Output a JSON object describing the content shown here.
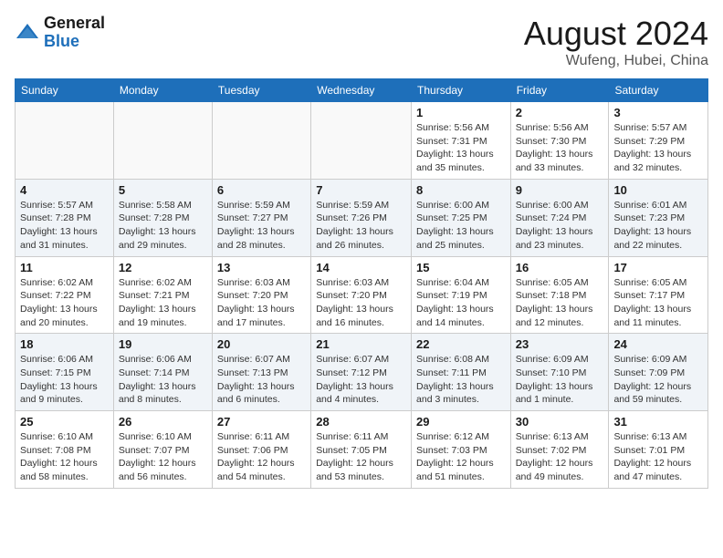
{
  "header": {
    "logo_general": "General",
    "logo_blue": "Blue",
    "month_year": "August 2024",
    "location": "Wufeng, Hubei, China"
  },
  "days_of_week": [
    "Sunday",
    "Monday",
    "Tuesday",
    "Wednesday",
    "Thursday",
    "Friday",
    "Saturday"
  ],
  "weeks": [
    [
      {
        "day": "",
        "info": ""
      },
      {
        "day": "",
        "info": ""
      },
      {
        "day": "",
        "info": ""
      },
      {
        "day": "",
        "info": ""
      },
      {
        "day": "1",
        "info": "Sunrise: 5:56 AM\nSunset: 7:31 PM\nDaylight: 13 hours and 35 minutes."
      },
      {
        "day": "2",
        "info": "Sunrise: 5:56 AM\nSunset: 7:30 PM\nDaylight: 13 hours and 33 minutes."
      },
      {
        "day": "3",
        "info": "Sunrise: 5:57 AM\nSunset: 7:29 PM\nDaylight: 13 hours and 32 minutes."
      }
    ],
    [
      {
        "day": "4",
        "info": "Sunrise: 5:57 AM\nSunset: 7:28 PM\nDaylight: 13 hours and 31 minutes."
      },
      {
        "day": "5",
        "info": "Sunrise: 5:58 AM\nSunset: 7:28 PM\nDaylight: 13 hours and 29 minutes."
      },
      {
        "day": "6",
        "info": "Sunrise: 5:59 AM\nSunset: 7:27 PM\nDaylight: 13 hours and 28 minutes."
      },
      {
        "day": "7",
        "info": "Sunrise: 5:59 AM\nSunset: 7:26 PM\nDaylight: 13 hours and 26 minutes."
      },
      {
        "day": "8",
        "info": "Sunrise: 6:00 AM\nSunset: 7:25 PM\nDaylight: 13 hours and 25 minutes."
      },
      {
        "day": "9",
        "info": "Sunrise: 6:00 AM\nSunset: 7:24 PM\nDaylight: 13 hours and 23 minutes."
      },
      {
        "day": "10",
        "info": "Sunrise: 6:01 AM\nSunset: 7:23 PM\nDaylight: 13 hours and 22 minutes."
      }
    ],
    [
      {
        "day": "11",
        "info": "Sunrise: 6:02 AM\nSunset: 7:22 PM\nDaylight: 13 hours and 20 minutes."
      },
      {
        "day": "12",
        "info": "Sunrise: 6:02 AM\nSunset: 7:21 PM\nDaylight: 13 hours and 19 minutes."
      },
      {
        "day": "13",
        "info": "Sunrise: 6:03 AM\nSunset: 7:20 PM\nDaylight: 13 hours and 17 minutes."
      },
      {
        "day": "14",
        "info": "Sunrise: 6:03 AM\nSunset: 7:20 PM\nDaylight: 13 hours and 16 minutes."
      },
      {
        "day": "15",
        "info": "Sunrise: 6:04 AM\nSunset: 7:19 PM\nDaylight: 13 hours and 14 minutes."
      },
      {
        "day": "16",
        "info": "Sunrise: 6:05 AM\nSunset: 7:18 PM\nDaylight: 13 hours and 12 minutes."
      },
      {
        "day": "17",
        "info": "Sunrise: 6:05 AM\nSunset: 7:17 PM\nDaylight: 13 hours and 11 minutes."
      }
    ],
    [
      {
        "day": "18",
        "info": "Sunrise: 6:06 AM\nSunset: 7:15 PM\nDaylight: 13 hours and 9 minutes."
      },
      {
        "day": "19",
        "info": "Sunrise: 6:06 AM\nSunset: 7:14 PM\nDaylight: 13 hours and 8 minutes."
      },
      {
        "day": "20",
        "info": "Sunrise: 6:07 AM\nSunset: 7:13 PM\nDaylight: 13 hours and 6 minutes."
      },
      {
        "day": "21",
        "info": "Sunrise: 6:07 AM\nSunset: 7:12 PM\nDaylight: 13 hours and 4 minutes."
      },
      {
        "day": "22",
        "info": "Sunrise: 6:08 AM\nSunset: 7:11 PM\nDaylight: 13 hours and 3 minutes."
      },
      {
        "day": "23",
        "info": "Sunrise: 6:09 AM\nSunset: 7:10 PM\nDaylight: 13 hours and 1 minute."
      },
      {
        "day": "24",
        "info": "Sunrise: 6:09 AM\nSunset: 7:09 PM\nDaylight: 12 hours and 59 minutes."
      }
    ],
    [
      {
        "day": "25",
        "info": "Sunrise: 6:10 AM\nSunset: 7:08 PM\nDaylight: 12 hours and 58 minutes."
      },
      {
        "day": "26",
        "info": "Sunrise: 6:10 AM\nSunset: 7:07 PM\nDaylight: 12 hours and 56 minutes."
      },
      {
        "day": "27",
        "info": "Sunrise: 6:11 AM\nSunset: 7:06 PM\nDaylight: 12 hours and 54 minutes."
      },
      {
        "day": "28",
        "info": "Sunrise: 6:11 AM\nSunset: 7:05 PM\nDaylight: 12 hours and 53 minutes."
      },
      {
        "day": "29",
        "info": "Sunrise: 6:12 AM\nSunset: 7:03 PM\nDaylight: 12 hours and 51 minutes."
      },
      {
        "day": "30",
        "info": "Sunrise: 6:13 AM\nSunset: 7:02 PM\nDaylight: 12 hours and 49 minutes."
      },
      {
        "day": "31",
        "info": "Sunrise: 6:13 AM\nSunset: 7:01 PM\nDaylight: 12 hours and 47 minutes."
      }
    ]
  ]
}
